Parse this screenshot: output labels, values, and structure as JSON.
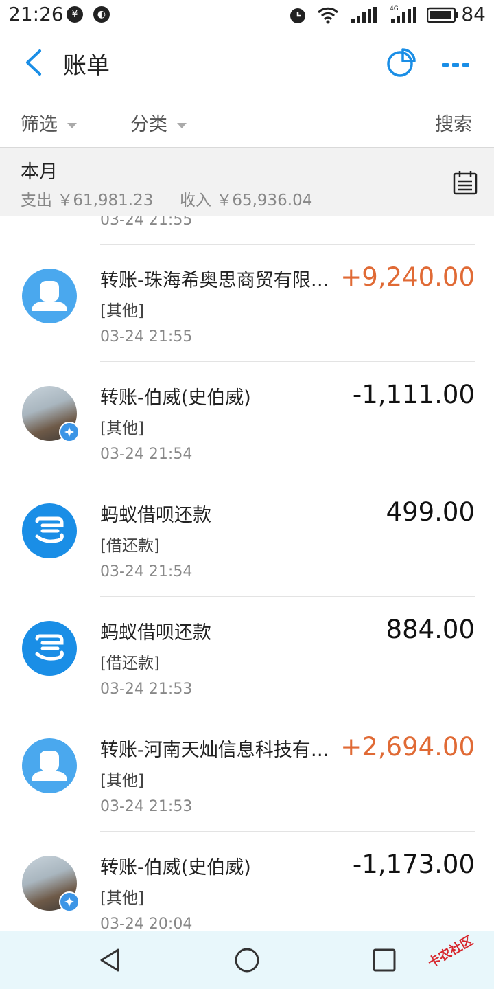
{
  "status_bar": {
    "time": "21:26",
    "battery": "84"
  },
  "nav": {
    "title": "账单"
  },
  "filter_bar": {
    "filter_label": "筛选",
    "category_label": "分类",
    "search_label": "搜索"
  },
  "summary": {
    "month_label": "本月",
    "expense_label": "支出",
    "expense_amount": "￥61,981.23",
    "income_label": "收入",
    "income_amount": "￥65,936.04"
  },
  "partial_row_time": "03-24  21:55",
  "transactions": [
    {
      "name": "转账-珠海希奥思商贸有限公司",
      "category": "[其他]",
      "time": "03-24  21:55",
      "amount": "+9,240.00",
      "type": "income",
      "avatar": "default-person"
    },
    {
      "name": "转账-伯威(史伯威)",
      "category": "[其他]",
      "time": "03-24  21:54",
      "amount": "-1,111.00",
      "type": "expense",
      "avatar": "photo"
    },
    {
      "name": "蚂蚁借呗还款",
      "category": "[借还款]",
      "time": "03-24  21:54",
      "amount": "499.00",
      "type": "neutral",
      "avatar": "loan"
    },
    {
      "name": "蚂蚁借呗还款",
      "category": "[借还款]",
      "time": "03-24  21:53",
      "amount": "884.00",
      "type": "neutral",
      "avatar": "loan"
    },
    {
      "name": "转账-河南天灿信息科技有限公司",
      "category": "[其他]",
      "time": "03-24  21:53",
      "amount": "+2,694.00",
      "type": "income",
      "avatar": "default-person"
    },
    {
      "name": "转账-伯威(史伯威)",
      "category": "[其他]",
      "time": "03-24  20:04",
      "amount": "-1,173.00",
      "type": "expense",
      "avatar": "photo"
    }
  ],
  "watermark": "卡农社区",
  "colors": {
    "accent": "#1a8ee6",
    "income": "#e06a35",
    "nav_bg": "#e8f7fb"
  }
}
